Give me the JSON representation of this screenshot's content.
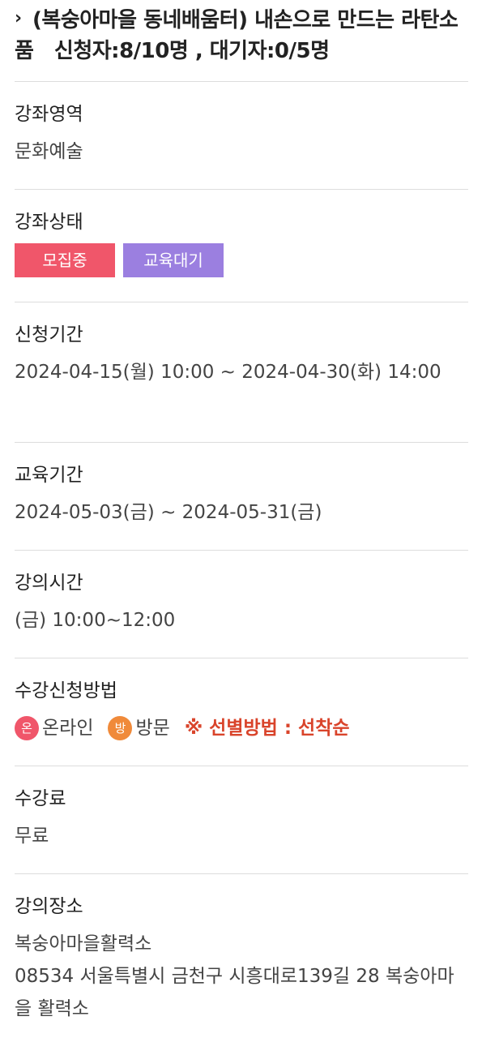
{
  "title": {
    "text": "(복숭아마을 동네배움터) 내손으로 만드는 라탄소품　신청자:8/10명 , 대기자:0/5명",
    "chevron": "›"
  },
  "sections": {
    "area": {
      "label": "강좌영역",
      "value": "문화예술"
    },
    "status": {
      "label": "강좌상태",
      "badges": [
        {
          "text": "모집중",
          "color": "#f0566a"
        },
        {
          "text": "교육대기",
          "color": "#9b7fe0"
        }
      ]
    },
    "apply_period": {
      "label": "신청기간",
      "value": "2024-04-15(월) 10:00 ~ 2024-04-30(화) 14:00"
    },
    "edu_period": {
      "label": "교육기간",
      "value": "2024-05-03(금) ~ 2024-05-31(금)"
    },
    "lecture_time": {
      "label": "강의시간",
      "value": "(금) 10:00~12:00"
    },
    "method": {
      "label": "수강신청방법",
      "online": {
        "icon": "온",
        "text": "온라인",
        "color": "#f0566a"
      },
      "visit": {
        "icon": "방",
        "text": "방문",
        "color": "#f08a3a"
      },
      "selection": {
        "text": "※ 선별방법 : 선착순",
        "color": "#d9442b"
      }
    },
    "fee": {
      "label": "수강료",
      "value": "무료"
    },
    "place": {
      "label": "강의장소",
      "name": "복숭아마을활력소",
      "address": "08534 서울특별시 금천구 시흥대로139길 28 복숭아마을 활력소"
    }
  }
}
